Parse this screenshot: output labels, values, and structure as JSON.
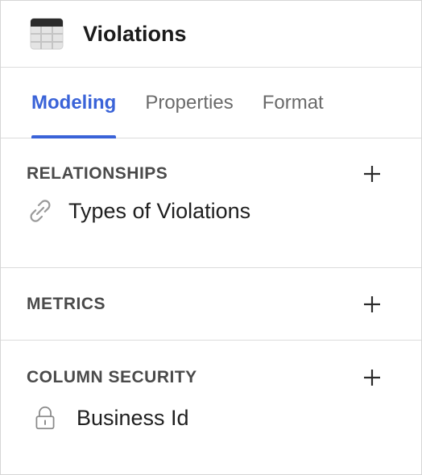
{
  "header": {
    "icon": "table-icon",
    "title": "Violations"
  },
  "tabs": [
    {
      "label": "Modeling",
      "active": true
    },
    {
      "label": "Properties",
      "active": false
    },
    {
      "label": "Format",
      "active": false
    }
  ],
  "sections": {
    "relationships": {
      "title": "RELATIONSHIPS",
      "add_icon": "plus-icon",
      "items": [
        {
          "icon": "link-icon",
          "label": "Types of Violations"
        }
      ]
    },
    "metrics": {
      "title": "METRICS",
      "add_icon": "plus-icon",
      "items": []
    },
    "column_security": {
      "title": "COLUMN SECURITY",
      "add_icon": "plus-icon",
      "items": [
        {
          "icon": "lock-icon",
          "label": "Business Id"
        }
      ]
    }
  },
  "colors": {
    "accent": "#3a63d8",
    "divider": "#dcdcdc",
    "muted_text": "#6a6a6a"
  }
}
